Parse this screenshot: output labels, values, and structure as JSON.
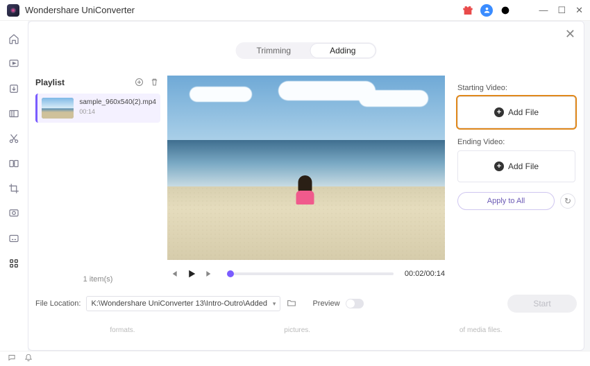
{
  "app": {
    "title": "Wondershare UniConverter"
  },
  "tabs": {
    "trimming": "Trimming",
    "adding": "Adding"
  },
  "playlist": {
    "header": "Playlist",
    "item": {
      "name": "sample_960x540(2).mp4",
      "duration": "00:14"
    },
    "count": "1 item(s)"
  },
  "player": {
    "time": "00:02/00:14"
  },
  "right": {
    "starting_label": "Starting Video:",
    "ending_label": "Ending Video:",
    "add_file": "Add File",
    "apply_all": "Apply to All"
  },
  "footer": {
    "file_location_label": "File Location:",
    "file_location_path": "K:\\Wondershare UniConverter 13\\Intro-Outro\\Added",
    "preview_label": "Preview",
    "start": "Start",
    "blurb1": "formats.",
    "blurb2": "pictures.",
    "blurb3": "of media files."
  }
}
